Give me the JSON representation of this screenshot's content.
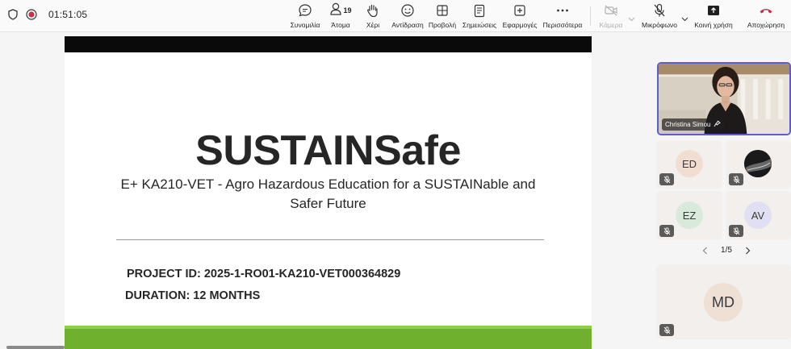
{
  "meeting": {
    "timer": "01:51:05"
  },
  "toolbar": {
    "chat_label": "Συνομιλία",
    "people_label": "Άτομα",
    "people_count": "19",
    "raise_label": "Χέρι",
    "react_label": "Αντίδραση",
    "view_label": "Προβολή",
    "notes_label": "Σημειώσεις",
    "apps_label": "Εφαρμογές",
    "more_label": "Περισσότερα",
    "camera_label": "Κάμερα",
    "mic_label": "Μικρόφωνο",
    "share_label": "Κοινή χρήση",
    "leave_label": "Αποχώρηση"
  },
  "slide": {
    "title": "SUSTAINSafe",
    "subtitle": "E+ KA210-VET - Agro Hazardous Education for a SUSTAINable and Safer Future",
    "project_id": "PROJECT ID: 2025-1-RO01-KA210-VET000364829",
    "duration": "DURATION: 12 MONTHS"
  },
  "participants": {
    "main": {
      "name": "Christina Simou"
    },
    "tiles": [
      {
        "initials": "ED",
        "avatar_color": "#f1ddd2"
      },
      {
        "initials": "",
        "avatar_color": "#1a1a1a"
      },
      {
        "initials": "EZ",
        "avatar_color": "#d9eadc"
      },
      {
        "initials": "AV",
        "avatar_color": "#e1e0f2"
      },
      {
        "initials": "MD",
        "avatar_color": "#efe0d6"
      }
    ],
    "pager": "1/5"
  },
  "colors": {
    "accent": "#5b5fc7",
    "record": "#c4314b",
    "leave": "#c4314b",
    "slide_green": "#6fb12e"
  }
}
